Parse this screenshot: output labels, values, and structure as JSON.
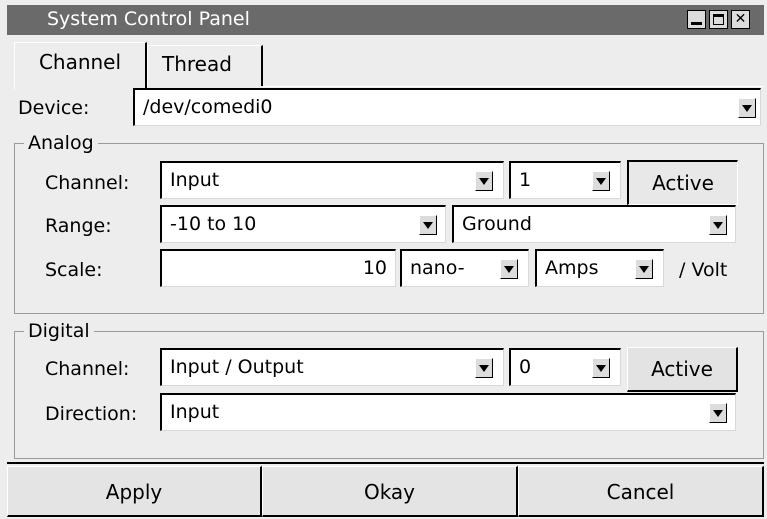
{
  "window": {
    "title": "System Control Panel"
  },
  "tabs": [
    {
      "label": "Channel"
    },
    {
      "label": "Thread"
    }
  ],
  "device": {
    "label": "Device:",
    "value": "/dev/comedi0"
  },
  "analog": {
    "legend": "Analog",
    "channel": {
      "label": "Channel:",
      "type": "Input",
      "number": "1",
      "button": "Active"
    },
    "range": {
      "label": "Range:",
      "value": "-10 to 10",
      "reference": "Ground"
    },
    "scale": {
      "label": "Scale:",
      "value": "10",
      "prefix": "nano-",
      "unit": "Amps",
      "suffix": "/ Volt"
    }
  },
  "digital": {
    "legend": "Digital",
    "channel": {
      "label": "Channel:",
      "type": "Input / Output",
      "number": "0",
      "button": "Active"
    },
    "direction": {
      "label": "Direction:",
      "value": "Input"
    }
  },
  "footer": {
    "apply": "Apply",
    "okay": "Okay",
    "cancel": "Cancel"
  },
  "colors": {
    "titlebar": "#6a6a6a",
    "window_bg": "#ededed",
    "field_bg": "#ffffff"
  }
}
